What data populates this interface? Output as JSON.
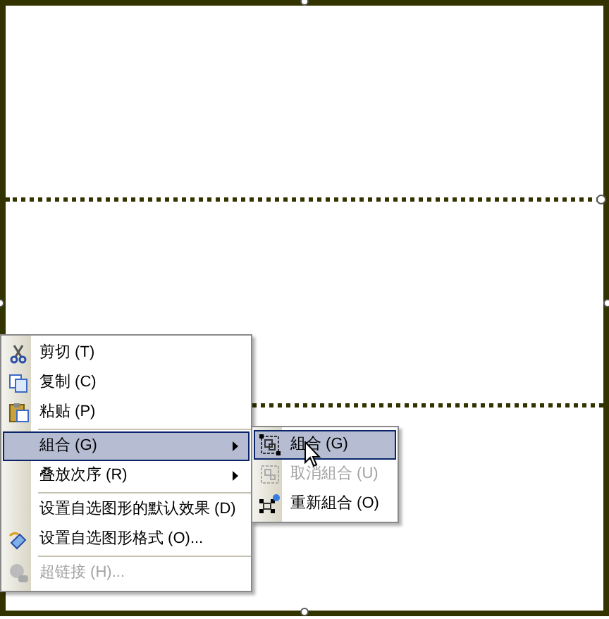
{
  "context_menu": {
    "items": [
      {
        "kind": "item",
        "label": "剪切 (T)",
        "selected": false,
        "disabled": false,
        "has_submenu": false
      },
      {
        "kind": "item",
        "label": "复制 (C)",
        "selected": false,
        "disabled": false,
        "has_submenu": false
      },
      {
        "kind": "item",
        "label": "粘贴 (P)",
        "selected": false,
        "disabled": false,
        "has_submenu": false
      },
      {
        "kind": "separator"
      },
      {
        "kind": "item",
        "label": "組合 (G)",
        "selected": true,
        "disabled": false,
        "has_submenu": true
      },
      {
        "kind": "item",
        "label": "叠放次序 (R)",
        "selected": false,
        "disabled": false,
        "has_submenu": true
      },
      {
        "kind": "separator"
      },
      {
        "kind": "item",
        "label": "设置自选图形的默认效果 (D)",
        "selected": false,
        "disabled": false,
        "has_submenu": false
      },
      {
        "kind": "item",
        "label": "设置自选图形格式 (O)...",
        "selected": false,
        "disabled": false,
        "has_submenu": false
      },
      {
        "kind": "separator"
      },
      {
        "kind": "item",
        "label": "超链接 (H)...",
        "selected": false,
        "disabled": true,
        "has_submenu": false
      }
    ]
  },
  "submenu": {
    "items": [
      {
        "label": "組合 (G)",
        "selected": true,
        "disabled": false
      },
      {
        "label": "取消組合 (U)",
        "selected": false,
        "disabled": true
      },
      {
        "label": "重新組合 (O)",
        "selected": false,
        "disabled": false
      }
    ]
  }
}
